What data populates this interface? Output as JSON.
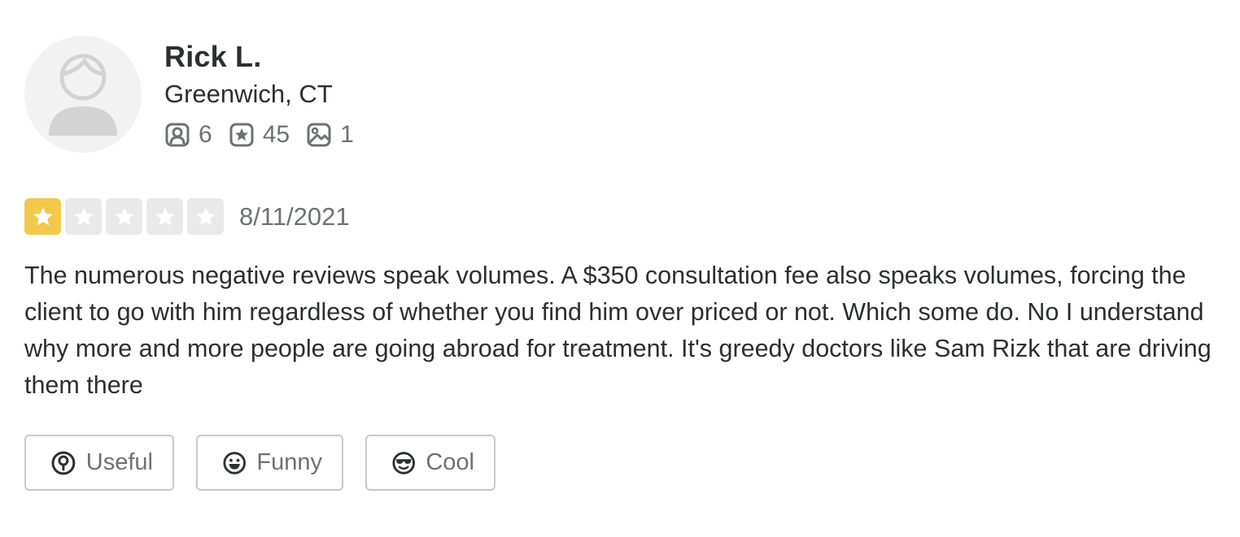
{
  "user": {
    "name": "Rick L.",
    "location": "Greenwich, CT",
    "stats": {
      "friends": "6",
      "reviews": "45",
      "photos": "1"
    }
  },
  "review": {
    "rating": 1,
    "max_rating": 5,
    "date": "8/11/2021",
    "text": "The numerous negative reviews speak volumes. A $350 consultation fee also speaks volumes, forcing the client to go with him regardless of whether you find him over priced or not. Which some do. No I understand why more and more people are going abroad for treatment. It's greedy doctors like Sam Rizk that are driving them there"
  },
  "reactions": {
    "useful_label": "Useful",
    "funny_label": "Funny",
    "cool_label": "Cool"
  },
  "colors": {
    "star_filled": "#f2c94c",
    "star_empty": "#e9e9e9",
    "text": "#2d2e2f",
    "muted": "#6e7072"
  }
}
